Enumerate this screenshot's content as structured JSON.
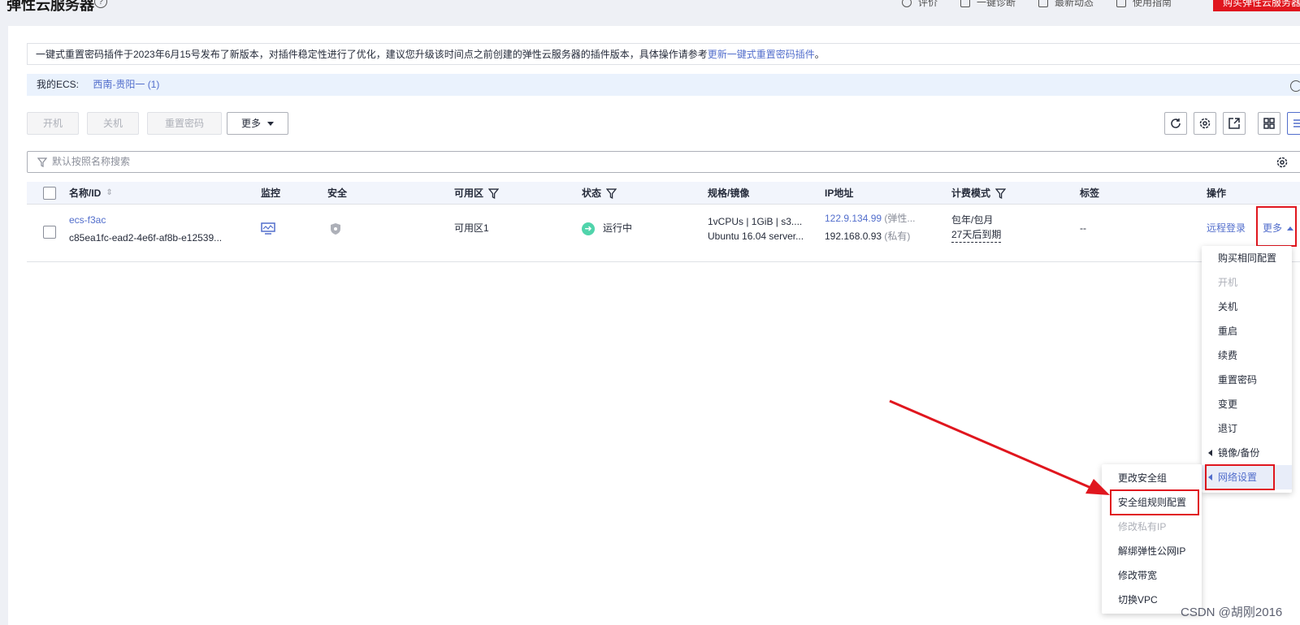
{
  "header": {
    "title": "弹性云服务器",
    "help": "?",
    "links": [
      "评价",
      "一键诊断",
      "最新动态",
      "使用指南"
    ],
    "buy_button": "购买弹性云服务器"
  },
  "notice": {
    "text": "一键式重置密码插件于2023年6月15号发布了新版本，对插件稳定性进行了优化，建议您升级该时间点之前创建的弹性云服务器的插件版本，具体操作请参考",
    "link": "更新一键式重置密码插件",
    "suffix": "。"
  },
  "region": {
    "label": "我的ECS:",
    "value": "西南-贵阳一 (1)"
  },
  "toolbar": {
    "start": "开机",
    "stop": "关机",
    "reset_password": "重置密码",
    "more": "更多"
  },
  "search": {
    "placeholder": "默认按照名称搜索"
  },
  "table": {
    "headers": {
      "name": "名称/ID",
      "monitor": "监控",
      "security": "安全",
      "az": "可用区",
      "status": "状态",
      "spec": "规格/镜像",
      "ip": "IP地址",
      "billing": "计费模式",
      "tags": "标签",
      "ops": "操作"
    },
    "row": {
      "name": "ecs-f3ac",
      "id": "c85ea1fc-ead2-4e6f-af8b-e12539...",
      "az": "可用区1",
      "status": "运行中",
      "spec_line1": "1vCPUs | 1GiB | s3....",
      "spec_line2": "Ubuntu 16.04 server...",
      "ip_public": "122.9.134.99",
      "ip_public_note": "(弹性...",
      "ip_private": "192.168.0.93",
      "ip_private_note": "(私有)",
      "billing_mode": "包年/包月",
      "billing_expiry": "27天后到期",
      "tags": "--",
      "remote_login": "远程登录",
      "more": "更多"
    }
  },
  "more_menu": {
    "items": [
      "购买相同配置",
      "开机",
      "关机",
      "重启",
      "续费",
      "重置密码",
      "变更",
      "退订",
      "镜像/备份",
      "网络设置"
    ]
  },
  "network_menu": {
    "items": [
      "更改安全组",
      "安全组规则配置",
      "修改私有IP",
      "解绑弹性公网IP",
      "修改带宽",
      "切换VPC"
    ]
  },
  "watermark": "CSDN @胡刚2016",
  "colors": {
    "accent": "#526ecc",
    "brand_red": "#e0161e",
    "running": "#50d4ab"
  }
}
